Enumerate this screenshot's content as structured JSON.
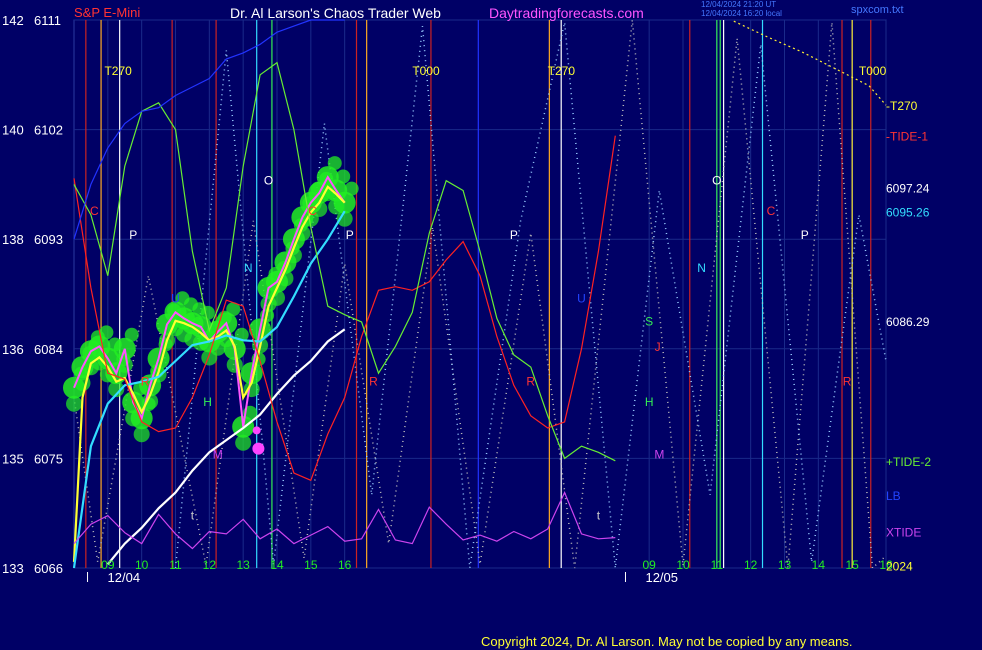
{
  "header": {
    "symbol": "S&P E-Mini",
    "title": "Dr. Al Larson's Chaos Trader Web",
    "site": "Daytradingforecasts.com",
    "stamp1": "12/04/2024 21:20 UT",
    "stamp2": "12/04/2024 16:20 local",
    "filename": "spxcom.txt"
  },
  "copyright": "Copyright 2024, Dr. Al Larson. May not be copied by any means.",
  "colors": {
    "background": "#000066",
    "grid": "#1a2a8a",
    "price_bars": "#ff55ff",
    "highlight": "#22ee22",
    "fast_ma": "#ffff33",
    "mid_ma": "#33ddff",
    "slow_ma": "#ffffff",
    "tide1": "#ff2222",
    "tide2": "#66ee33",
    "lb": "#2233ff",
    "xtide": "#cc44ee",
    "t270": "#ffee33",
    "vline_red": "#cc2222",
    "vline_orange": "#ffaa22",
    "vline_cyan": "#33ddff",
    "vline_green": "#33ee55",
    "vline_white": "#ffffff"
  },
  "chart_data": {
    "type": "line",
    "title": "S&P E-Mini",
    "y_left_inner_labels": [
      "133",
      "135",
      "136",
      "138",
      "140",
      "142"
    ],
    "y_left_outer_labels": [
      "6066",
      "6075",
      "6084",
      "6093",
      "6102",
      "6111"
    ],
    "ylim": [
      6066,
      6111
    ],
    "x_tick_labels": [
      "09",
      "10",
      "11",
      "12",
      "13",
      "14",
      "15",
      "16",
      "09",
      "10",
      "11",
      "12",
      "13",
      "14",
      "15",
      "16"
    ],
    "x_tick_hours": [
      9,
      10,
      11,
      12,
      13,
      14,
      15,
      16,
      25,
      26,
      27,
      28,
      29,
      30,
      31,
      32
    ],
    "date_labels": [
      {
        "text": "12/04",
        "hour": 8.4
      },
      {
        "text": "12/05",
        "hour": 24.3
      }
    ],
    "xlim": [
      8.0,
      32.0
    ],
    "right_labels": [
      {
        "text": "-T270",
        "value": 6104.0,
        "color": "#ffff33"
      },
      {
        "text": "-TIDE-1",
        "value": 6101.5,
        "color": "#ff3333"
      },
      {
        "text": "6097.24",
        "value": 6097.24,
        "color": "#ffffff"
      },
      {
        "text": "6095.26",
        "value": 6095.26,
        "color": "#33ddff"
      },
      {
        "text": "6086.29",
        "value": 6086.29,
        "color": "#ffffff"
      },
      {
        "text": "+TIDE-2",
        "value": 6074.8,
        "color": "#66ee33"
      },
      {
        "text": "LB",
        "value": 6072.0,
        "color": "#2244ff"
      },
      {
        "text": "XTIDE",
        "value": 6069.0,
        "color": "#cc44ee"
      },
      {
        "text": "2024",
        "value": 6066.2,
        "color": "#ffff33"
      }
    ],
    "top_labels": [
      {
        "text": "T270",
        "hour": 8.9
      },
      {
        "text": "T000",
        "hour": 18.0
      },
      {
        "text": "T270",
        "hour": 22.0
      },
      {
        "text": "T000",
        "hour": 31.2
      }
    ],
    "vertical_lines": [
      {
        "hour": 8.35,
        "color": "#cc2222"
      },
      {
        "hour": 8.8,
        "color": "#ffaa22"
      },
      {
        "hour": 9.35,
        "color": "#ffffff"
      },
      {
        "hour": 10.9,
        "color": "#cc2222"
      },
      {
        "hour": 12.2,
        "color": "#cc2222"
      },
      {
        "hour": 13.4,
        "color": "#33ddff"
      },
      {
        "hour": 13.85,
        "color": "#33ee55"
      },
      {
        "hour": 16.35,
        "color": "#cc2222"
      },
      {
        "hour": 16.65,
        "color": "#ffaa22"
      },
      {
        "hour": 18.55,
        "color": "#cc2222"
      },
      {
        "hour": 19.95,
        "color": "#2233ff"
      },
      {
        "hour": 22.05,
        "color": "#ffaa22"
      },
      {
        "hour": 22.4,
        "color": "#ffffff"
      },
      {
        "hour": 26.2,
        "color": "#cc2222"
      },
      {
        "hour": 27.0,
        "color": "#33ee55"
      },
      {
        "hour": 27.1,
        "color": "#33ee55"
      },
      {
        "hour": 27.2,
        "color": "#ffffff"
      },
      {
        "hour": 28.35,
        "color": "#33ddff"
      },
      {
        "hour": 30.7,
        "color": "#cc2222"
      },
      {
        "hour": 31.0,
        "color": "#ffee33"
      },
      {
        "hour": 31.55,
        "color": "#cc2222"
      }
    ],
    "letter_markers": [
      {
        "text": "C",
        "hour": 8.6,
        "value": 6095.0,
        "color": "#ff3333"
      },
      {
        "text": "P",
        "hour": 9.75,
        "value": 6093.0,
        "color": "#ffffff"
      },
      {
        "text": "R",
        "hour": 10.1,
        "value": 6081.0,
        "color": "#ff3333"
      },
      {
        "text": "U",
        "hour": 11.0,
        "value": 6087.8,
        "color": "#2244ff"
      },
      {
        "text": "t",
        "hour": 11.5,
        "value": 6070.0,
        "color": "#cccccc"
      },
      {
        "text": "H",
        "hour": 11.95,
        "value": 6079.3,
        "color": "#33ee55"
      },
      {
        "text": "M",
        "hour": 12.25,
        "value": 6075.0,
        "color": "#cc44ee"
      },
      {
        "text": "N",
        "hour": 13.15,
        "value": 6090.3,
        "color": "#33ddff"
      },
      {
        "text": "O",
        "hour": 13.75,
        "value": 6097.5,
        "color": "#ffffff"
      },
      {
        "text": "C",
        "hour": 15.05,
        "value": 6095.0,
        "color": "#ff3333"
      },
      {
        "text": "P",
        "hour": 16.15,
        "value": 6093.0,
        "color": "#ffffff"
      },
      {
        "text": "R",
        "hour": 16.85,
        "value": 6081.0,
        "color": "#ff3333"
      },
      {
        "text": "P",
        "hour": 21.0,
        "value": 6093.0,
        "color": "#ffffff"
      },
      {
        "text": "R",
        "hour": 21.5,
        "value": 6081.0,
        "color": "#ff3333"
      },
      {
        "text": "U",
        "hour": 23.0,
        "value": 6087.8,
        "color": "#2244ff"
      },
      {
        "text": "t",
        "hour": 23.5,
        "value": 6070.0,
        "color": "#cccccc"
      },
      {
        "text": "S",
        "hour": 25.0,
        "value": 6085.9,
        "color": "#33ee55"
      },
      {
        "text": "J",
        "hour": 25.25,
        "value": 6083.8,
        "color": "#ff3333"
      },
      {
        "text": "H",
        "hour": 25.0,
        "value": 6079.3,
        "color": "#33ee55"
      },
      {
        "text": "M",
        "hour": 25.3,
        "value": 6075.0,
        "color": "#cc44ee"
      },
      {
        "text": "N",
        "hour": 26.55,
        "value": 6090.3,
        "color": "#33ddff"
      },
      {
        "text": "O",
        "hour": 27.0,
        "value": 6097.5,
        "color": "#ffffff"
      },
      {
        "text": "C",
        "hour": 28.6,
        "value": 6095.0,
        "color": "#ff3333"
      },
      {
        "text": "P",
        "hour": 29.6,
        "value": 6093.0,
        "color": "#ffffff"
      },
      {
        "text": "R",
        "hour": 30.85,
        "value": 6081.0,
        "color": "#ff3333"
      }
    ],
    "series": [
      {
        "key": "price",
        "color": "#ff55ff",
        "x": [
          8.0,
          8.25,
          8.5,
          8.75,
          9.0,
          9.25,
          9.5,
          9.75,
          10.0,
          10.25,
          10.5,
          10.75,
          11.0,
          11.25,
          11.5,
          11.75,
          12.0,
          12.25,
          12.5,
          12.75,
          13.0,
          13.25,
          13.5,
          13.75,
          14.0,
          14.25,
          14.5,
          14.75,
          15.0,
          15.25,
          15.5,
          15.75,
          16.0
        ],
        "y": [
          6080.8,
          6082.5,
          6083.8,
          6084.2,
          6083.2,
          6082.0,
          6084.0,
          6079.6,
          6078.3,
          6081.0,
          6083.2,
          6086.0,
          6087.0,
          6086.5,
          6086.1,
          6085.8,
          6084.6,
          6085.4,
          6086.1,
          6084.0,
          6077.6,
          6082.0,
          6085.6,
          6089.0,
          6089.5,
          6091.1,
          6093.0,
          6094.8,
          6096.0,
          6096.8,
          6098.1,
          6097.0,
          6096.0
        ]
      },
      {
        "key": "fast_ma",
        "color": "#ffff33",
        "x": [
          8.0,
          8.25,
          8.5,
          8.75,
          9.0,
          9.25,
          9.5,
          9.75,
          10.0,
          10.25,
          10.5,
          10.75,
          11.0,
          11.25,
          11.5,
          11.75,
          12.0,
          12.25,
          12.5,
          12.75,
          13.0,
          13.25,
          13.5,
          13.75,
          14.0,
          14.25,
          14.5,
          14.75,
          15.0,
          15.25,
          15.5,
          15.75,
          16.0
        ],
        "y": [
          6066.5,
          6080.0,
          6082.8,
          6083.3,
          6082.5,
          6081.3,
          6081.6,
          6080.3,
          6078.8,
          6080.2,
          6082.1,
          6084.7,
          6086.3,
          6086.1,
          6085.8,
          6085.3,
          6084.7,
          6085.0,
          6085.5,
          6084.2,
          6080.0,
          6081.2,
          6084.2,
          6087.5,
          6089.0,
          6090.5,
          6092.3,
          6094.0,
          6095.2,
          6096.0,
          6097.3,
          6096.7,
          6096.0
        ]
      },
      {
        "key": "mid_ma",
        "color": "#33ddff",
        "x": [
          8.0,
          8.5,
          9.0,
          9.5,
          10.0,
          10.5,
          11.0,
          11.5,
          12.0,
          12.5,
          13.0,
          13.5,
          14.0,
          14.5,
          15.0,
          15.5,
          16.0
        ],
        "y": [
          6066.0,
          6076.0,
          6079.5,
          6081.0,
          6081.3,
          6081.7,
          6083.0,
          6084.3,
          6084.6,
          6085.1,
          6084.7,
          6084.6,
          6085.8,
          6088.3,
          6091.0,
          6093.0,
          6095.3
        ]
      },
      {
        "key": "slow_ma",
        "color": "#ffffff",
        "x": [
          9.0,
          9.5,
          10.0,
          10.5,
          11.0,
          11.5,
          12.0,
          12.5,
          13.0,
          13.5,
          14.0,
          14.5,
          15.0,
          15.5,
          16.0
        ],
        "y": [
          6066.3,
          6068.0,
          6069.3,
          6070.9,
          6072.2,
          6074.0,
          6075.5,
          6076.5,
          6077.5,
          6078.6,
          6080.3,
          6081.8,
          6083.0,
          6084.6,
          6085.6
        ]
      },
      {
        "key": "tide1",
        "color": "#ff2222",
        "x": [
          8.0,
          8.5,
          9.0,
          9.5,
          10.0,
          10.5,
          11.0,
          11.5,
          12.0,
          12.5,
          13.0,
          13.5,
          14.0,
          14.5,
          15.0,
          15.5,
          16.0,
          16.5,
          17.0,
          17.5,
          18.0,
          18.5,
          19.0,
          19.5,
          20.0,
          20.5,
          21.0,
          21.5,
          22.0,
          22.5,
          23.0,
          23.5,
          24.0
        ],
        "y": [
          6098.0,
          6089.0,
          6082.0,
          6081.5,
          6078.0,
          6077.2,
          6077.5,
          6080.0,
          6083.5,
          6088.0,
          6087.5,
          6083.0,
          6078.0,
          6073.8,
          6073.2,
          6077.0,
          6080.0,
          6085.0,
          6088.8,
          6089.1,
          6088.8,
          6089.5,
          6091.3,
          6092.8,
          6090.0,
          6085.0,
          6081.0,
          6078.5,
          6077.5,
          6078.0,
          6084.0,
          6092.0,
          6101.5
        ]
      },
      {
        "key": "tide2",
        "color": "#66ee33",
        "x": [
          8.0,
          8.5,
          9.0,
          9.5,
          10.0,
          10.5,
          11.0,
          11.5,
          12.0,
          12.5,
          13.0,
          13.5,
          14.0,
          14.5,
          15.0,
          15.5,
          16.0,
          16.5,
          17.0,
          17.5,
          18.0,
          18.5,
          19.0,
          19.5,
          20.0,
          20.5,
          21.0,
          21.5,
          22.0,
          22.5,
          23.0,
          23.5,
          24.0
        ],
        "y": [
          6097.5,
          6095.0,
          6090.0,
          6099.0,
          6103.5,
          6104.2,
          6102.0,
          6092.0,
          6085.5,
          6089.0,
          6099.0,
          6106.5,
          6107.5,
          6102.0,
          6094.0,
          6087.5,
          6086.8,
          6086.2,
          6082.0,
          6084.2,
          6087.0,
          6093.5,
          6097.8,
          6097.0,
          6092.0,
          6086.5,
          6083.5,
          6082.5,
          6078.5,
          6075.0,
          6076.0,
          6075.5,
          6074.8
        ]
      },
      {
        "key": "lb",
        "color": "#2233ff",
        "x": [
          8.0,
          8.5,
          9.0,
          9.5,
          10.0,
          10.5,
          11.0,
          11.5,
          12.0,
          12.5,
          13.0,
          13.5,
          14.0,
          14.5,
          15.0,
          15.5,
          16.0
        ],
        "y": [
          6093.0,
          6097.5,
          6100.5,
          6102.5,
          6103.5,
          6103.8,
          6104.8,
          6105.5,
          6106.2,
          6107.8,
          6108.3,
          6109.0,
          6110.0,
          6110.5,
          6111.0,
          6111.0,
          6111.0
        ]
      },
      {
        "key": "xtide",
        "color": "#cc44ee",
        "x": [
          8.0,
          8.5,
          9.0,
          9.5,
          10.0,
          10.5,
          11.0,
          11.5,
          12.0,
          12.5,
          13.0,
          13.5,
          14.0,
          14.5,
          15.0,
          15.5,
          16.0,
          16.5,
          17.0,
          17.5,
          18.0,
          18.5,
          19.0,
          19.5,
          20.0,
          20.5,
          21.0,
          21.5,
          22.0,
          22.5,
          23.0,
          23.5,
          24.0
        ],
        "y": [
          6068.0,
          6069.6,
          6070.3,
          6068.9,
          6068.0,
          6070.4,
          6068.8,
          6067.6,
          6069.0,
          6068.8,
          6070.0,
          6068.4,
          6069.2,
          6068.0,
          6068.7,
          6069.4,
          6068.2,
          6068.4,
          6070.8,
          6068.3,
          6068.0,
          6071.0,
          6069.6,
          6068.3,
          6068.7,
          6068.2,
          6069.0,
          6068.4,
          6069.2,
          6072.2,
          6068.8,
          6068.4,
          6068.5
        ]
      },
      {
        "key": "t270",
        "color": "#ffee33",
        "x": [
          27.5,
          28.5,
          29.5,
          30.5,
          31.5,
          32.0
        ],
        "y": [
          6110.9,
          6109.6,
          6108.4,
          6107.0,
          6105.6,
          6104.0
        ]
      }
    ],
    "dotted_zigzags": [
      {
        "color": "#bbbbbb",
        "x": [
          8.0,
          8.7,
          10.2,
          11.9,
          13.3,
          14.8,
          16.0,
          17.3,
          18.6,
          20.0,
          21.5,
          22.8,
          24.5,
          26.0,
          27.6,
          29.1,
          30.4,
          31.6,
          32.0
        ],
        "y": [
          6080.0,
          6066.5,
          6090.0,
          6066.2,
          6094.5,
          6066.8,
          6091.0,
          6068.0,
          6094.0,
          6066.3,
          6093.5,
          6066.0,
          6111.0,
          6066.2,
          6109.5,
          6066.0,
          6110.8,
          6066.0,
          6067.0
        ]
      },
      {
        "color": "#99ccff",
        "x": [
          11.0,
          12.5,
          13.9,
          15.4,
          16.8,
          18.3,
          19.7,
          21.2,
          22.5,
          24.0,
          25.3,
          26.8,
          28.3,
          29.8,
          31.2,
          32.0
        ],
        "y": [
          6066.0,
          6108.5,
          6066.3,
          6102.5,
          6072.0,
          6110.5,
          6066.0,
          6094.5,
          6110.8,
          6066.0,
          6097.0,
          6072.0,
          6109.0,
          6066.5,
          6095.0,
          6083.0
        ]
      }
    ],
    "markers": [
      {
        "hour": 13.45,
        "value": 6075.8,
        "color": "#ff44ff",
        "size": 6
      },
      {
        "hour": 13.4,
        "value": 6077.3,
        "color": "#ff44ff",
        "size": 4
      }
    ],
    "grid": true
  }
}
